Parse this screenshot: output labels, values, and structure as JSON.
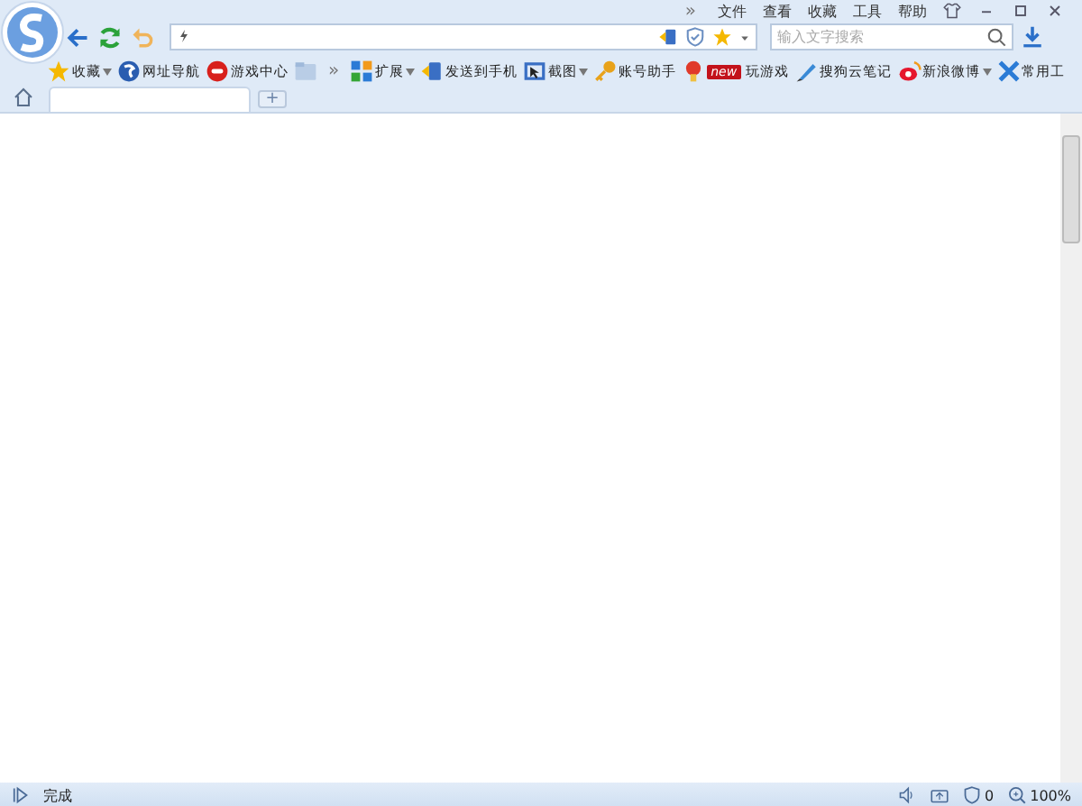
{
  "menu": [
    "文件",
    "查看",
    "收藏",
    "工具",
    "帮助"
  ],
  "menu_overflow": "»",
  "search": {
    "placeholder": "输入文字搜索"
  },
  "bookmarks": [
    {
      "label": "收藏",
      "dropdown": true
    },
    {
      "label": "网址导航",
      "dropdown": false
    },
    {
      "label": "游戏中心",
      "dropdown": false
    }
  ],
  "bookmarks_overflow": "»",
  "extensions": [
    {
      "label": "扩展",
      "dropdown": true
    },
    {
      "label": "发送到手机",
      "dropdown": false
    },
    {
      "label": "截图",
      "dropdown": true
    },
    {
      "label": "账号助手",
      "dropdown": false
    },
    {
      "label": "玩游戏",
      "dropdown": false,
      "badge": "new"
    },
    {
      "label": "搜狗云笔记",
      "dropdown": false
    },
    {
      "label": "新浪微博",
      "dropdown": true
    },
    {
      "label": "常用工",
      "dropdown": false
    }
  ],
  "tabs": [
    {
      "selected": true
    }
  ],
  "new_tab": "+",
  "status_bar": {
    "text": "完成",
    "blocked_count": "0",
    "zoom": "100%"
  }
}
